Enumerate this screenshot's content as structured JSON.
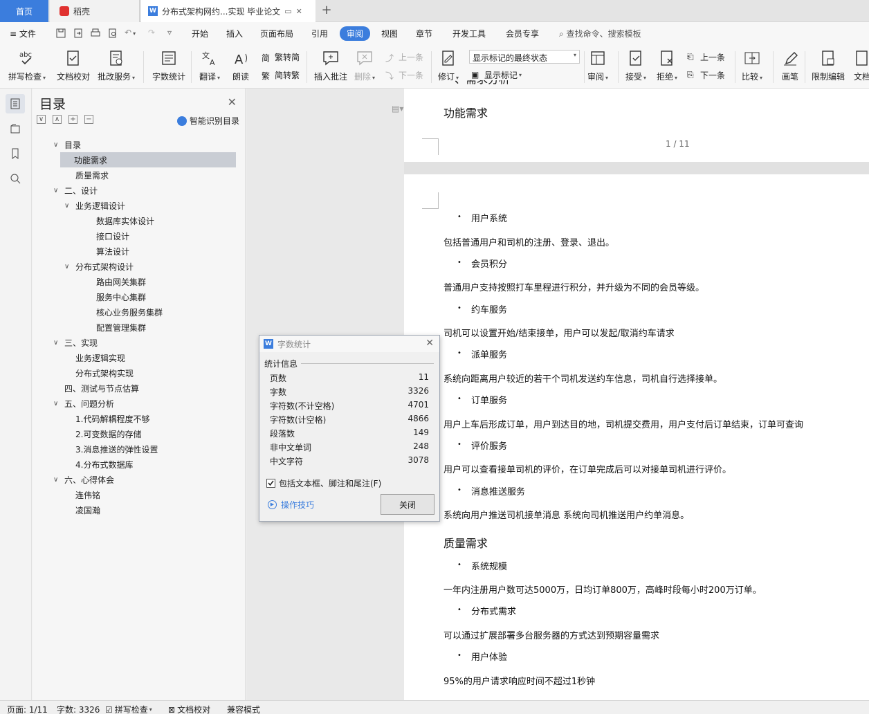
{
  "titlebar": {
    "home_tab": "首页",
    "daoke_tab": "稻壳",
    "doc_tab": "分布式架构网约...实现 毕业论文"
  },
  "menu": {
    "file": "文件",
    "items": [
      "开始",
      "插入",
      "页面布局",
      "引用",
      "审阅",
      "视图",
      "章节",
      "开发工具",
      "会员专享"
    ],
    "active": "审阅",
    "search": "查找命令、搜索模板"
  },
  "ribbon": {
    "spell": "拼写检查",
    "doc_check": "文档校对",
    "batch_service": "批改服务",
    "word_count": "字数统计",
    "translate": "翻译",
    "read_aloud": "朗读",
    "trad_to_simp": "繁转简",
    "simp_to_trad": "简转繁",
    "insert_comment": "插入批注",
    "delete": "删除",
    "prev_comment": "上一条",
    "next_comment": "下一条",
    "revise": "修订",
    "markup_state": "显示标记的最终状态",
    "show_markup": "显示标记",
    "review": "审阅",
    "accept": "接受",
    "reject": "拒绝",
    "prev": "上一条",
    "next": "下一条",
    "compare": "比较",
    "pen": "画笔",
    "restrict_edit": "限制编辑",
    "doc_more": "文档"
  },
  "toc": {
    "title": "目录",
    "smart": "智能识别目录",
    "items": [
      {
        "label": "目录",
        "level": 1,
        "caret": "∨"
      },
      {
        "label": "功能需求",
        "level": 2,
        "caret": "",
        "selected": true
      },
      {
        "label": "质量需求",
        "level": 2,
        "caret": ""
      },
      {
        "label": "二、设计",
        "level": 1,
        "caret": "∨"
      },
      {
        "label": "业务逻辑设计",
        "level": 2,
        "caret": "∨"
      },
      {
        "label": "数据库实体设计",
        "level": 3,
        "caret": ""
      },
      {
        "label": "接口设计",
        "level": 3,
        "caret": ""
      },
      {
        "label": "算法设计",
        "level": 3,
        "caret": ""
      },
      {
        "label": "分布式架构设计",
        "level": 2,
        "caret": "∨"
      },
      {
        "label": "路由网关集群",
        "level": 3,
        "caret": ""
      },
      {
        "label": "服务中心集群",
        "level": 3,
        "caret": ""
      },
      {
        "label": "核心业务服务集群",
        "level": 3,
        "caret": ""
      },
      {
        "label": "配置管理集群",
        "level": 3,
        "caret": ""
      },
      {
        "label": "三、实现",
        "level": 1,
        "caret": "∨"
      },
      {
        "label": "业务逻辑实现",
        "level": 2,
        "caret": ""
      },
      {
        "label": "分布式架构实现",
        "level": 2,
        "caret": ""
      },
      {
        "label": "四、测试与节点估算",
        "level": 1,
        "caret": ""
      },
      {
        "label": "五、问题分析",
        "level": 1,
        "caret": "∨"
      },
      {
        "label": "1.代码解耦程度不够",
        "level": 2,
        "caret": ""
      },
      {
        "label": "2.可变数据的存储",
        "level": 2,
        "caret": ""
      },
      {
        "label": "3.消息推送的弹性设置",
        "level": 2,
        "caret": ""
      },
      {
        "label": "4.分布式数据库",
        "level": 2,
        "caret": ""
      },
      {
        "label": "六、心得体会",
        "level": 1,
        "caret": "∨"
      },
      {
        "label": "连伟铭",
        "level": 2,
        "caret": ""
      },
      {
        "label": "凌国瀚",
        "level": 2,
        "caret": ""
      }
    ]
  },
  "doc": {
    "page1_cut_heading": "一、需求分析",
    "page1_heading": "功能需求",
    "page_number": "1 / 11",
    "lines": [
      {
        "type": "bullet",
        "text": "用户系统"
      },
      {
        "type": "para",
        "text": "包括普通用户和司机的注册、登录、退出。"
      },
      {
        "type": "bullet",
        "text": "会员积分"
      },
      {
        "type": "para",
        "text": "普通用户支持按照打车里程进行积分，并升级为不同的会员等级。"
      },
      {
        "type": "bullet",
        "text": "约车服务"
      },
      {
        "type": "para",
        "text": "司机可以设置开始/结束接单，用户可以发起/取消约车请求"
      },
      {
        "type": "bullet",
        "text": "派单服务"
      },
      {
        "type": "para",
        "text": "系统向距离用户较近的若干个司机发送约车信息，司机自行选择接单。"
      },
      {
        "type": "bullet",
        "text": "订单服务"
      },
      {
        "type": "para",
        "text": "用户上车后形成订单，用户到达目的地，司机提交费用，用户支付后订单结束，订单可查询"
      },
      {
        "type": "bullet",
        "text": "评价服务"
      },
      {
        "type": "para",
        "text": "用户可以查看接单司机的评价，在订单完成后可以对接单司机进行评价。"
      },
      {
        "type": "bullet",
        "text": "消息推送服务"
      },
      {
        "type": "para",
        "text": "系统向用户推送司机接单消息 系统向司机推送用户约单消息。"
      },
      {
        "type": "heading",
        "text": "质量需求"
      },
      {
        "type": "bullet",
        "text": "系统规模"
      },
      {
        "type": "para",
        "text": "一年内注册用户数可达5000万，日均订单800万，高峰时段每小时200万订单。"
      },
      {
        "type": "bullet",
        "text": "分布式需求"
      },
      {
        "type": "para",
        "text": "可以通过扩展部署多台服务器的方式达到预期容量需求"
      },
      {
        "type": "bullet",
        "text": "用户体验"
      },
      {
        "type": "para",
        "text": "95%的用户请求响应时间不超过1秒钟"
      }
    ]
  },
  "dialog": {
    "title": "字数统计",
    "group": "统计信息",
    "stats": [
      {
        "label": "页数",
        "value": "11"
      },
      {
        "label": "字数",
        "value": "3326"
      },
      {
        "label": "字符数(不计空格)",
        "value": "4701"
      },
      {
        "label": "字符数(计空格)",
        "value": "4866"
      },
      {
        "label": "段落数",
        "value": "149"
      },
      {
        "label": "非中文单词",
        "value": "248"
      },
      {
        "label": "中文字符",
        "value": "3078"
      }
    ],
    "include_label": "包括文本框、脚注和尾注(F)",
    "tips": "操作技巧",
    "close": "关闭"
  },
  "status": {
    "page": "页面: 1/11",
    "words": "字数: 3326",
    "spell": "拼写检查",
    "doc_check": "文档校对",
    "compat": "兼容模式"
  },
  "colors": {
    "accent": "#3b7ddd"
  }
}
